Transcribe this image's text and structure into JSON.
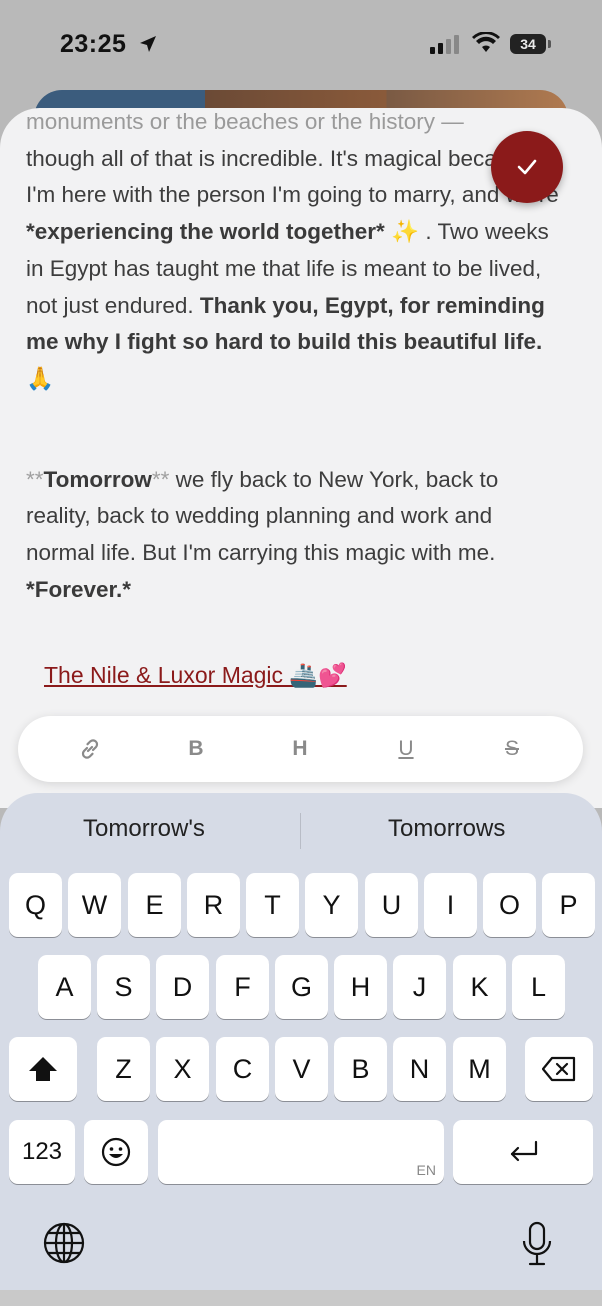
{
  "status": {
    "time": "23:25",
    "battery": "34"
  },
  "editor": {
    "line1": "monuments or the beaches or the history —",
    "p1_a": "though all of that is incredible. It's magical because I'm here with the person I'm going to marry, and we're ",
    "p1_b": "*experiencing the world together*",
    "p1_c": " ✨ . Two weeks in Egypt has taught me that life is meant to be lived, not just endured. ",
    "p1_d": "Thank you, Egypt, for reminding me why I fight so hard to build this beautiful life.",
    "p1_e": " 🙏",
    "p2_mk1": "**",
    "p2_b": "Tomorrow",
    "p2_mk2": "**",
    "p2_c": " we fly back to New York, back to reality, back to wedding planning and work and normal life. But I'm carrying this magic with me. ",
    "p2_d": "*Forever.*",
    "link": "The Nile & Luxor Magic 🚢💕"
  },
  "toolbar": {
    "link_icon": "link-icon",
    "bold": "B",
    "heading": "H",
    "underline": "U",
    "strike": "S"
  },
  "keyboard": {
    "suggestions": [
      "Tomorrow's",
      "Tomorrows"
    ],
    "row1": [
      "Q",
      "W",
      "E",
      "R",
      "T",
      "Y",
      "U",
      "I",
      "O",
      "P"
    ],
    "row2": [
      "A",
      "S",
      "D",
      "F",
      "G",
      "H",
      "J",
      "K",
      "L"
    ],
    "row3": [
      "Z",
      "X",
      "C",
      "V",
      "B",
      "N",
      "M"
    ],
    "numbers_key": "123",
    "space_lang": "EN",
    "icons": [
      "shift-icon",
      "backspace-icon",
      "emoji-icon",
      "return-icon",
      "globe-icon",
      "microphone-icon"
    ]
  },
  "colors": {
    "accent": "#8b1a1a",
    "keyboard_bg": "#d6dbe6",
    "sheet_bg": "#f2f2f3"
  }
}
